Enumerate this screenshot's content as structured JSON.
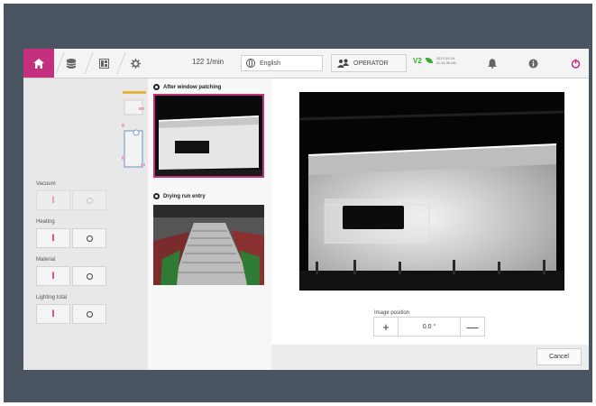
{
  "topbar": {
    "home_icon": "home-icon",
    "speed": "122 1/min",
    "language": "English",
    "role": "OPERATOR",
    "version_label": "V2",
    "version_date": "2013-09-18",
    "version_time": "11:16:35 AM",
    "accent": "#c2307e"
  },
  "left": {
    "controls": [
      {
        "label": "Vacuum",
        "enabled": false
      },
      {
        "label": "Heating",
        "enabled": true
      },
      {
        "label": "Material",
        "enabled": true
      },
      {
        "label": "Lighting total",
        "enabled": true
      }
    ],
    "on_symbol": "I"
  },
  "cameras": [
    {
      "title": "After window patching",
      "selected": true
    },
    {
      "title": "Drying run entry",
      "selected": false
    }
  ],
  "main": {
    "image_position_label": "Image position",
    "image_position_value": "0.0 °",
    "plus": "+",
    "minus": "—",
    "cancel_label": "Cancel"
  }
}
